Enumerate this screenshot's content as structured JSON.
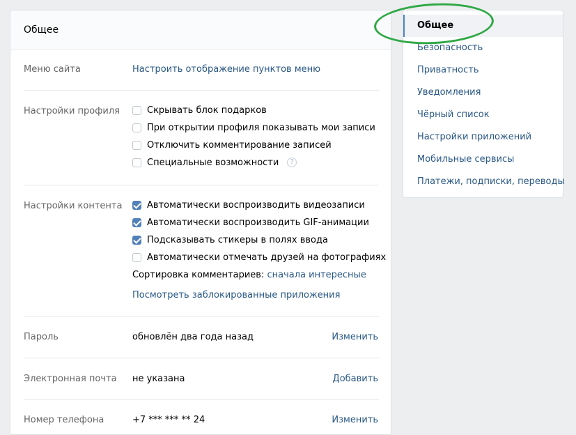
{
  "header": {
    "title": "Общее"
  },
  "menu_row": {
    "label": "Меню сайта",
    "link": "Настроить отображение пунктов меню"
  },
  "profile": {
    "label": "Настройки профиля",
    "options": [
      {
        "text": "Скрывать блок подарков",
        "checked": false
      },
      {
        "text": "При открытии профиля показывать мои записи",
        "checked": false
      },
      {
        "text": "Отключить комментирование записей",
        "checked": false
      },
      {
        "text": "Специальные возможности",
        "checked": false,
        "help": "?"
      }
    ]
  },
  "content": {
    "label": "Настройки контента",
    "options": [
      {
        "text": "Автоматически воспроизводить видеозаписи",
        "checked": true
      },
      {
        "text": "Автоматически воспроизводить GIF-анимации",
        "checked": true
      },
      {
        "text": "Подсказывать стикеры в полях ввода",
        "checked": true
      },
      {
        "text": "Автоматически отмечать друзей на фотографиях",
        "checked": false
      }
    ],
    "sort_label": "Сортировка комментариев:",
    "sort_value": "сначала интересные",
    "blocked_apps_link": "Посмотреть заблокированные приложения"
  },
  "password": {
    "label": "Пароль",
    "value": "обновлён два года назад",
    "action": "Изменить"
  },
  "email": {
    "label": "Электронная почта",
    "value": "не указана",
    "action": "Добавить"
  },
  "phone": {
    "label": "Номер телефона",
    "value": "+7 *** *** ** 24",
    "action": "Изменить"
  },
  "sidebar": {
    "items": [
      {
        "label": "Общее",
        "active": true
      },
      {
        "label": "Безопасность"
      },
      {
        "label": "Приватность"
      },
      {
        "label": "Уведомления"
      },
      {
        "label": "Чёрный список"
      },
      {
        "label": "Настройки приложений"
      },
      {
        "label": "Мобильные сервисы"
      },
      {
        "label": "Платежи, подписки, переводы"
      }
    ]
  },
  "colors": {
    "link": "#2a5885",
    "accent": "#5181b8",
    "highlight": "#2fa845"
  }
}
